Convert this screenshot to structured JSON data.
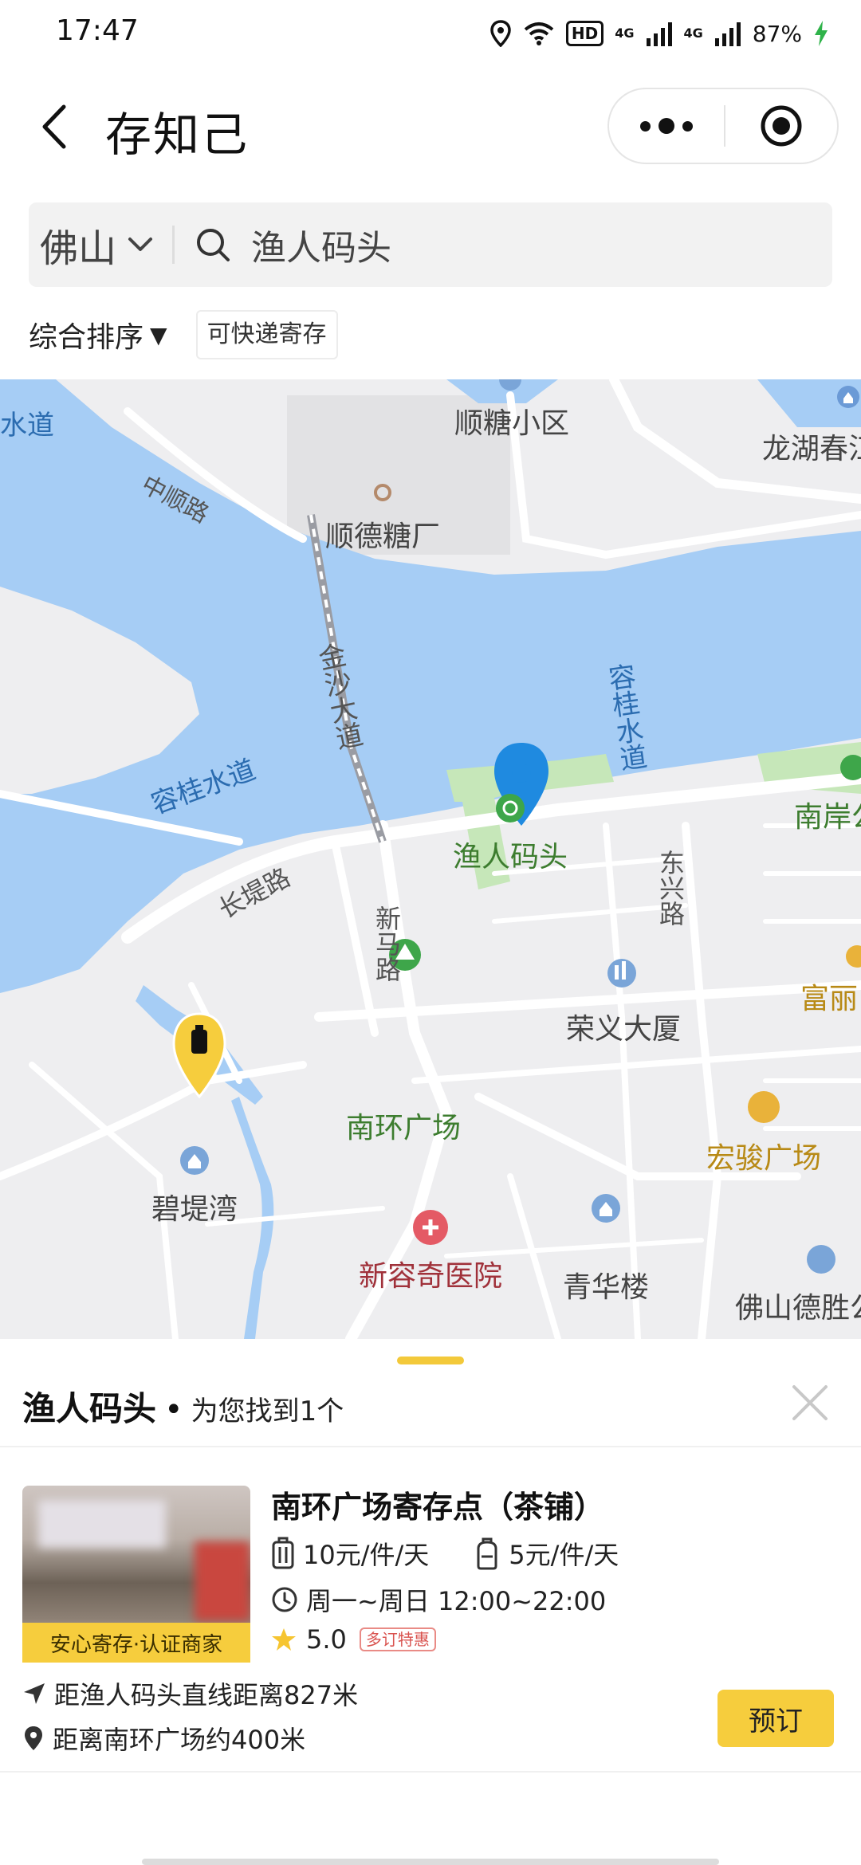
{
  "status_bar": {
    "time": "17:47",
    "hd": "HD",
    "net1": "4G",
    "net2": "4G",
    "battery": "87%"
  },
  "header": {
    "title": "存知己",
    "back_icon": "chevron-left-icon",
    "more_icon": "more-dots-icon",
    "close_icon": "target-circle-icon"
  },
  "search": {
    "city": "佛山",
    "query": "渔人码头"
  },
  "filters": {
    "sort_label": "综合排序",
    "sort_arrow": "▼",
    "tag_label": "可快递寄存"
  },
  "map": {
    "labels": {
      "water_top_left": "水道",
      "shuntang": "顺糖小区",
      "longhu": "龙湖春江",
      "zhongshun_road": "中顺路",
      "shunde_sugar": "顺德糖厂",
      "jinsha": "金沙大道",
      "ronggui_vertical": "容桂水道",
      "ronggui_water": "容桂水道",
      "fisherman": "渔人码头",
      "nanan": "南岸公",
      "changdi": "长堤路",
      "dongxing": "东兴路",
      "xinma": "新马路",
      "rongyi": "荣义大厦",
      "fuli": "富丽",
      "nanhuan": "南环广场",
      "hongjun": "宏骏广场",
      "biti": "碧堤湾",
      "xinrongqi": "新容奇医院",
      "qinghua": "青华楼",
      "foshan_desheng": "佛山德胜公"
    },
    "colors": {
      "water": "#a6cdf5",
      "land": "#eeeef0",
      "road": "#ffffff",
      "green": "#c6e7b9",
      "marker_blue": "#1f8ae0",
      "marker_yellow": "#f6cd3d"
    }
  },
  "sheet": {
    "keyword": "渔人码头",
    "dot": "•",
    "count_text": "为您找到1个",
    "result": {
      "name": "南环广场寄存点（茶铺）",
      "price_large": "10元/件/天",
      "price_small": "5元/件/天",
      "hours": "周一~周日 12:00~22:00",
      "rating": "5.0",
      "promo": "多订特惠",
      "badge": "安心寄存·认证商家",
      "distance_line": "距渔人码头直线距离827米",
      "distance_landmark": "距离南环广场约400米",
      "book_label": "预订"
    }
  }
}
